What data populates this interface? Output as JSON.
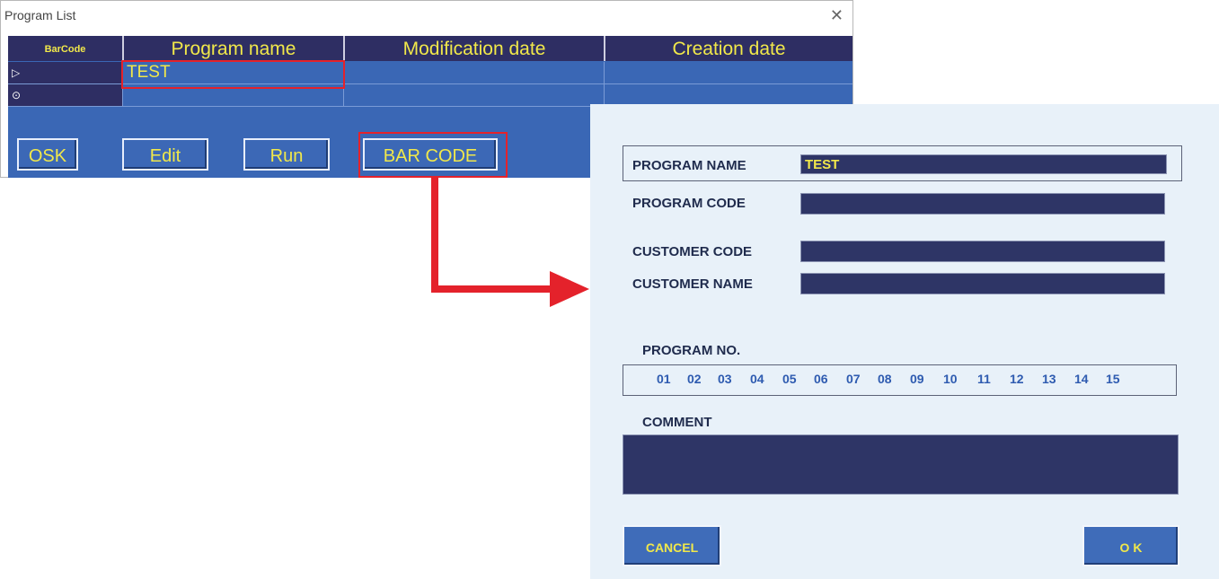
{
  "program_list": {
    "title": "Program List",
    "close_glyph": "✕",
    "columns": [
      "BarCode",
      "Program name",
      "Modification date",
      "Creation date"
    ],
    "rows": [
      {
        "marker": "▷",
        "program_name": "TEST",
        "modification_date": "",
        "creation_date": ""
      },
      {
        "marker": "⊙",
        "program_name": "",
        "modification_date": "",
        "creation_date": ""
      }
    ],
    "buttons": {
      "osk": "OSK",
      "edit": "Edit",
      "run": "Run",
      "barcode": "BAR CODE"
    }
  },
  "barcode_dialog": {
    "program_name_label": "PROGRAM NAME",
    "program_name_value": "TEST",
    "program_code_label": "PROGRAM CODE",
    "program_code_value": "",
    "customer_code_label": "CUSTOMER CODE",
    "customer_code_value": "",
    "customer_name_label": "CUSTOMER NAME",
    "customer_name_value": "",
    "program_no_label": "PROGRAM NO.",
    "program_numbers": [
      "01",
      "02",
      "03",
      "04",
      "05",
      "06",
      "07",
      "08",
      "09",
      "10",
      "11",
      "12",
      "13",
      "14",
      "15"
    ],
    "comment_label": "COMMENT",
    "comment_value": "",
    "cancel_label": "CANCEL",
    "ok_label": "O K"
  },
  "colors": {
    "highlight": "#e4222b",
    "grid_blue": "#3a67b5",
    "header_navy": "#2e2e63",
    "text_yellow": "#f1e84a",
    "dialog_bg": "#e8f1f9"
  }
}
